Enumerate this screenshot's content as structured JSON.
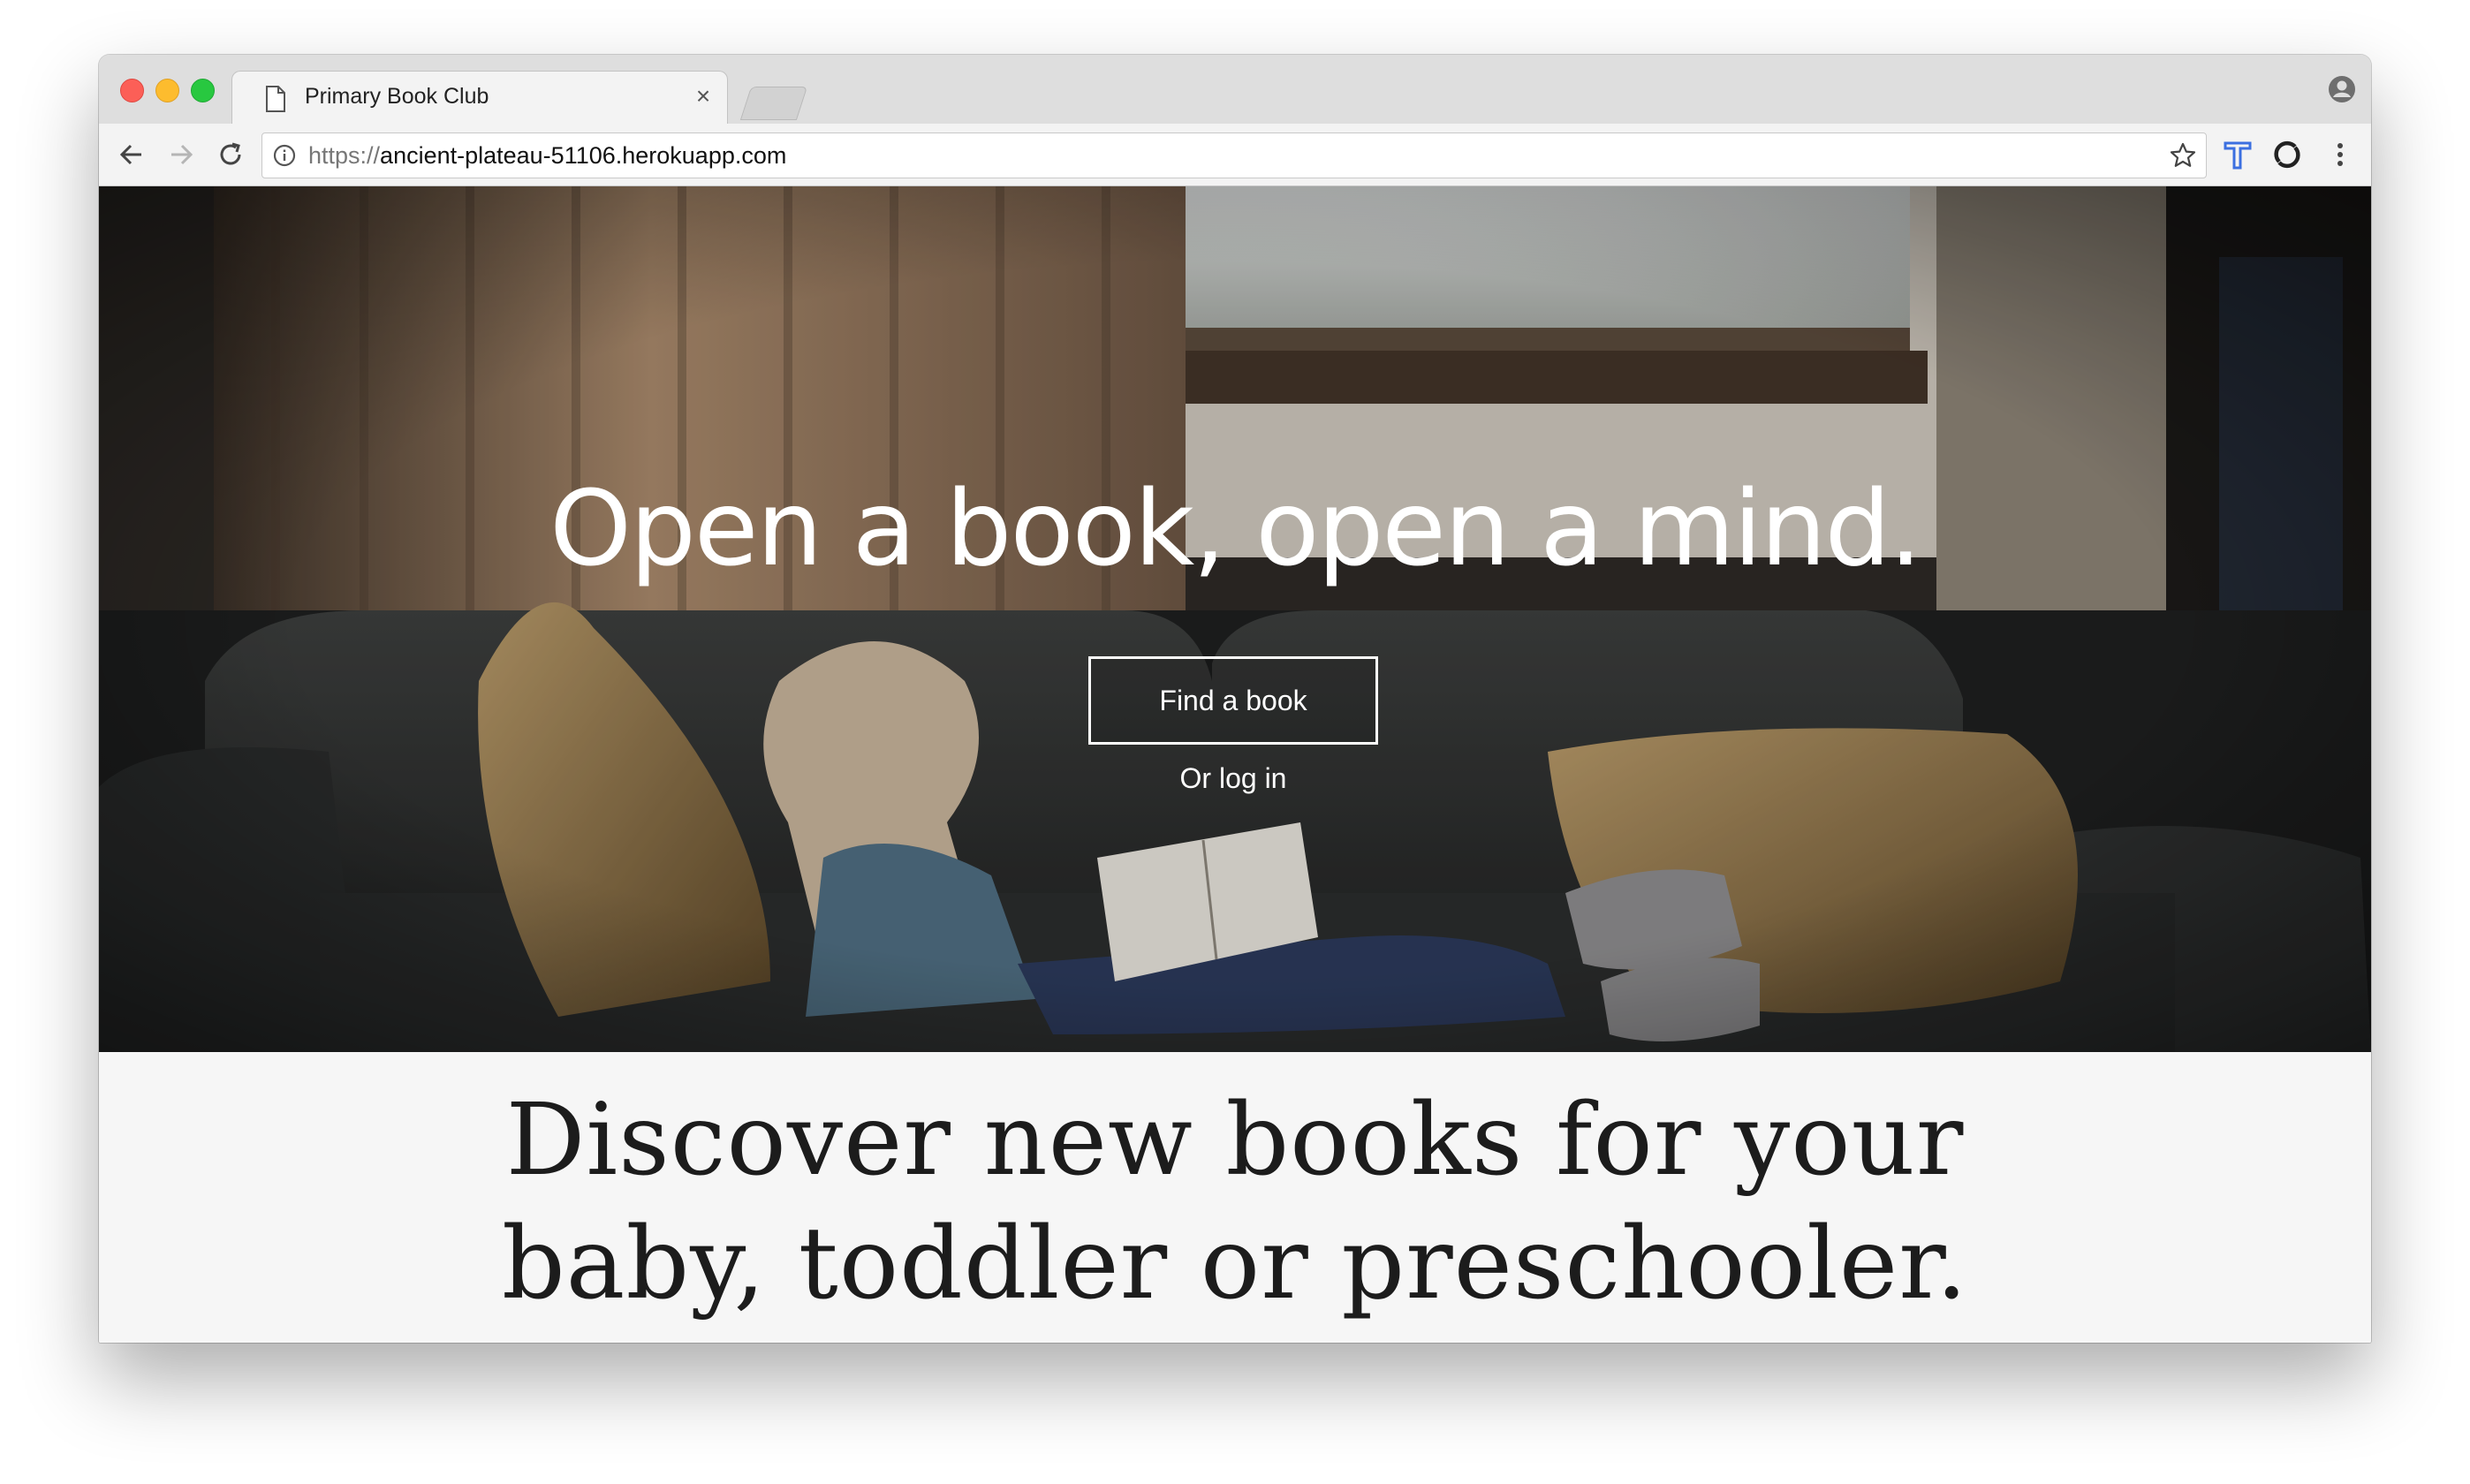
{
  "browser": {
    "tab_title": "Primary Book Club",
    "tab_close": "×",
    "url_scheme": "https://",
    "url_host": "ancient-plateau-51106.herokuapp.com"
  },
  "hero": {
    "headline": "Open a book, open a mind.",
    "cta_label": "Find a book",
    "login_label": "Or log in"
  },
  "discover": {
    "line1": "Discover new books for your",
    "line2": "baby, toddler or preschooler."
  },
  "icons": {
    "tab": "document-icon",
    "back": "back-arrow-icon",
    "forward": "forward-arrow-icon",
    "reload": "reload-icon",
    "info": "info-icon",
    "bookmark": "star-icon",
    "extension1": "t-extension-icon",
    "extension2": "s-extension-icon",
    "menu": "kebab-menu-icon",
    "profile": "profile-icon"
  },
  "colors": {
    "close": "#fc5f57",
    "minimize": "#fdbc2e",
    "maximize": "#28c840",
    "extension_blue": "#3b6fe0",
    "page_background": "#f6f6f6"
  }
}
